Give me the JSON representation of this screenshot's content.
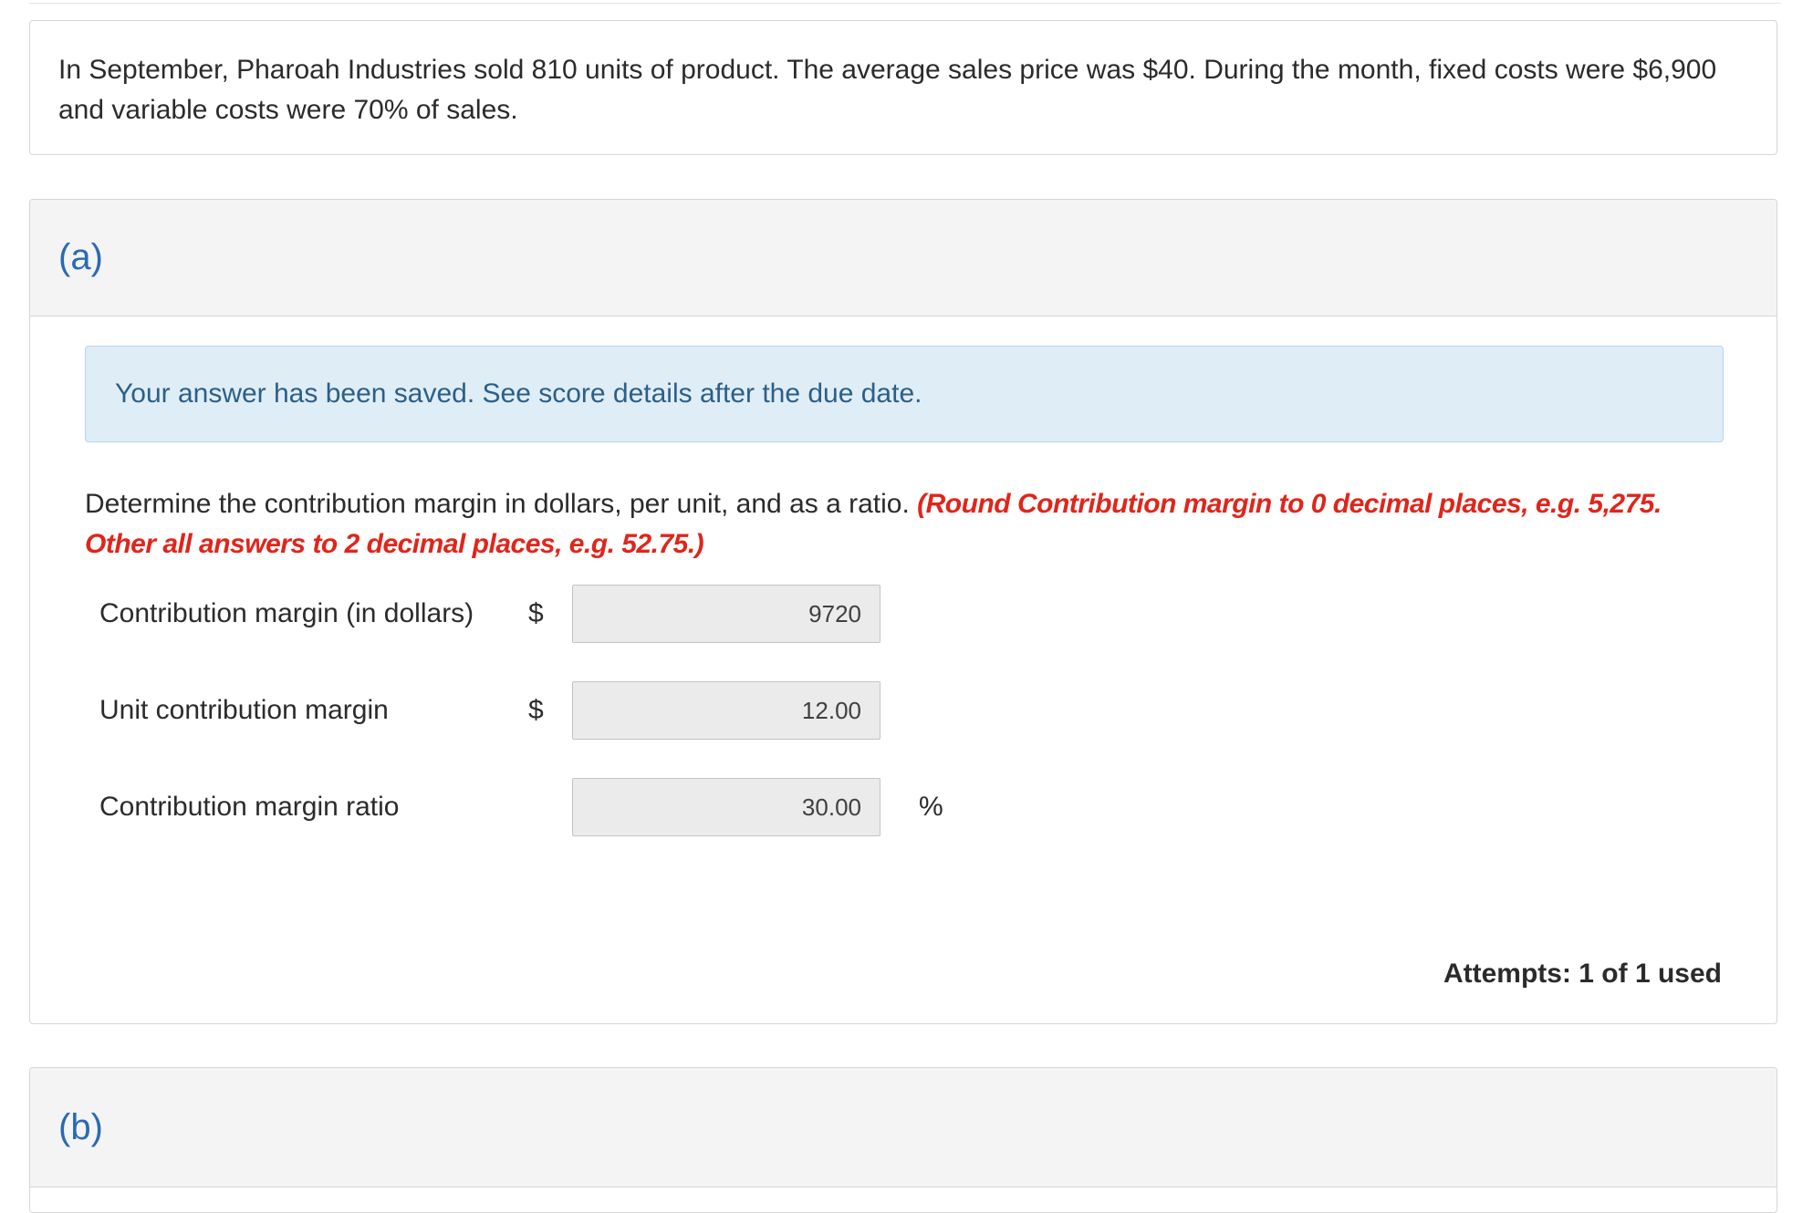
{
  "problem": {
    "text": "In September, Pharoah Industries sold 810 units of product. The average sales price was $40. During the month, fixed costs were $6,900 and variable costs were 70% of sales."
  },
  "part_a": {
    "header": "(a)",
    "alert": "Your answer has been saved. See score details after the due date.",
    "instruction": "Determine the contribution margin in dollars, per unit, and as a ratio.",
    "note": "(Round Contribution margin to 0 decimal places, e.g. 5,275. Other all answers to 2 decimal places, e.g. 52.75.)",
    "rows": [
      {
        "label": "Contribution margin (in dollars)",
        "currency": "$",
        "value": "9720",
        "unit": ""
      },
      {
        "label": "Unit contribution margin",
        "currency": "$",
        "value": "12.00",
        "unit": ""
      },
      {
        "label": "Contribution margin ratio",
        "currency": "",
        "value": "30.00",
        "unit": "%"
      }
    ],
    "attempts": "Attempts: 1 of 1 used"
  },
  "part_b": {
    "header": "(b)"
  }
}
